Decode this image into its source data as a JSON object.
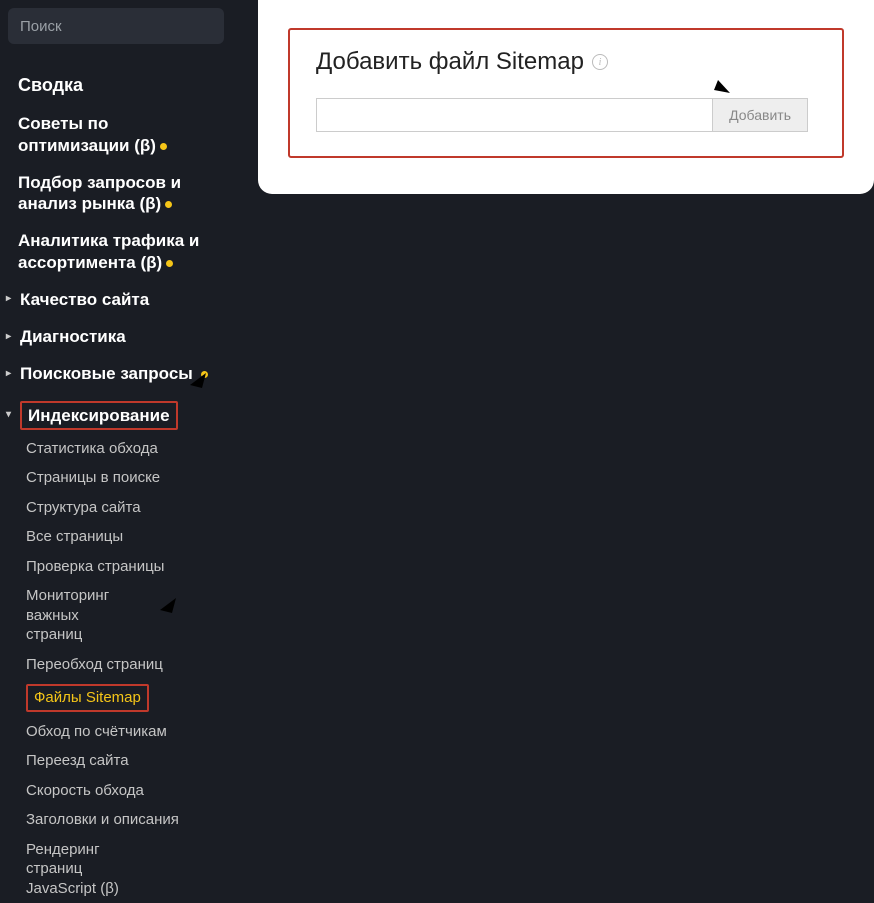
{
  "search": {
    "placeholder": "Поиск"
  },
  "sidebar": {
    "summary": "Сводка",
    "optimization_tips": "Советы по оптимизации (β)",
    "query_selection": "Подбор запросов и анализ рынка (β)",
    "traffic_analytics": "Аналитика трафика и ассортимента (β)",
    "site_quality": "Качество сайта",
    "diagnostics": "Диагностика",
    "search_queries": "Поисковые запросы",
    "indexing": "Индексирование",
    "indexing_sub": {
      "crawl_stats": "Статистика обхода",
      "pages_in_search": "Страницы в поиске",
      "site_structure": "Структура сайта",
      "all_pages": "Все страницы",
      "page_check": "Проверка страницы",
      "important_pages": "Мониторинг важных страниц",
      "recrawl": "Переобход страниц",
      "sitemap_files": "Файлы Sitemap",
      "crawl_by_counters": "Обход по счётчикам",
      "site_move": "Переезд сайта",
      "crawl_speed": "Скорость обхода",
      "titles_descriptions": "Заголовки и описания",
      "js_rendering": "Рендеринг страниц JavaScript (β)"
    }
  },
  "main_panel": {
    "title": "Добавить файл Sitemap",
    "input_value": "",
    "button_label": "Добавить"
  }
}
